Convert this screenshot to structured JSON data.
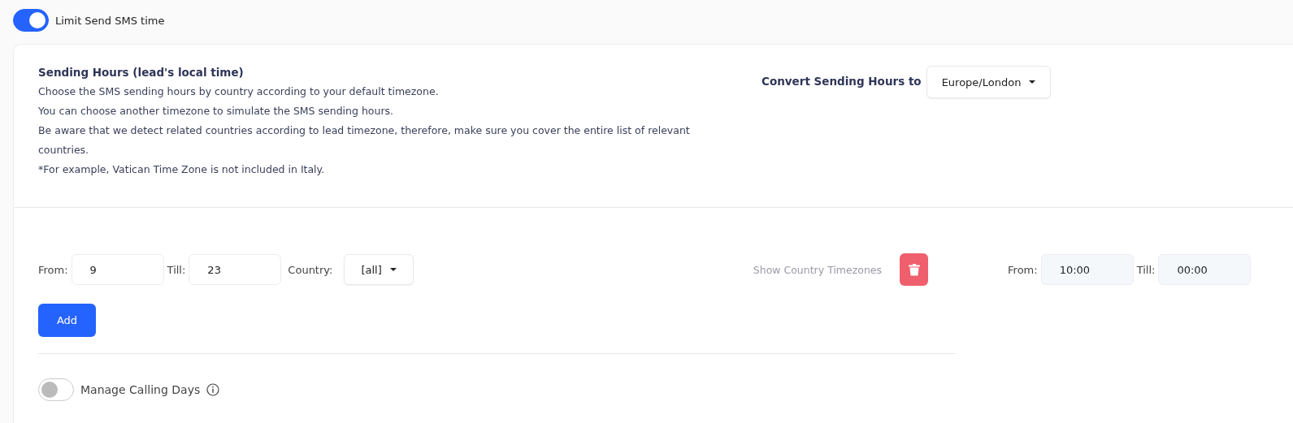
{
  "limit_toggle": {
    "label": "Limit Send SMS time",
    "on": true
  },
  "header": {
    "title": "Sending Hours (lead's local time)",
    "lines": [
      "Choose the SMS sending hours by country according to your default timezone.",
      "You can choose another timezone to simulate the SMS sending hours.",
      "Be aware that we detect related countries according to lead timezone, therefore, make sure you cover the entire list of relevant countries.",
      "*For example, Vatican Time Zone is not included in Italy."
    ],
    "convert_label": "Convert Sending Hours to",
    "timezone": "Europe/London"
  },
  "rule": {
    "from_label": "From:",
    "from": "9",
    "till_label": "Till:",
    "till": "23",
    "country_label": "Country:",
    "country": "[all]",
    "show_timezones": "Show Country Timezones",
    "converted": {
      "from_label": "From:",
      "from": "10:00",
      "till_label": "Till:",
      "till": "00:00"
    }
  },
  "add_button": "Add",
  "days_toggle": {
    "label": "Manage Calling Days",
    "on": false
  }
}
